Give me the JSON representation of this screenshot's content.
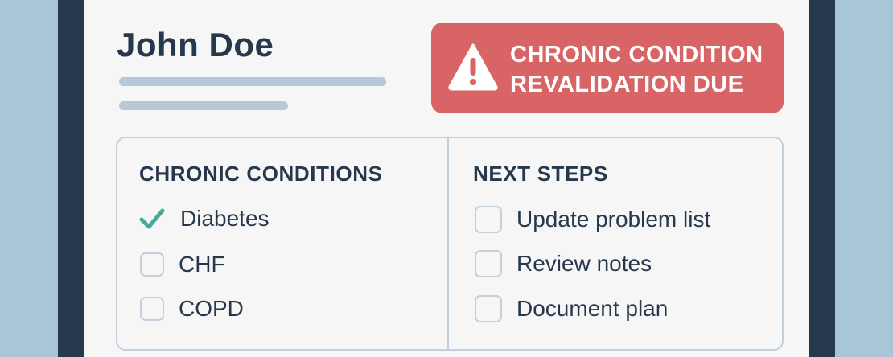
{
  "patient": {
    "name": "John Doe"
  },
  "alert": {
    "line1": "CHRONIC CONDITION",
    "line2": "REVALIDATION DUE",
    "icon": "warning-triangle-icon",
    "color": "#d96466"
  },
  "conditions": {
    "title": "CHRONIC CONDITIONS",
    "items": [
      {
        "label": "Diabetes",
        "checked": true
      },
      {
        "label": "CHF",
        "checked": false
      },
      {
        "label": "COPD",
        "checked": false
      }
    ]
  },
  "next_steps": {
    "title": "NEXT STEPS",
    "items": [
      {
        "label": "Update problem list",
        "checked": false
      },
      {
        "label": "Review notes",
        "checked": false
      },
      {
        "label": "Document plan",
        "checked": false
      }
    ]
  },
  "colors": {
    "check": "#4aa89a",
    "text": "#27384c",
    "frame": "#26384c",
    "background": "#a9c6d9"
  }
}
